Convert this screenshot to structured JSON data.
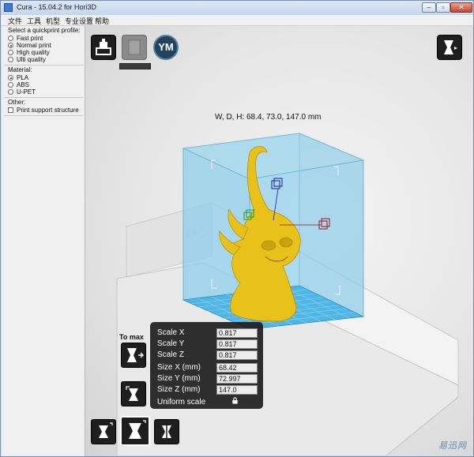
{
  "window": {
    "title": "Cura - 15.04.2 for Hori3D"
  },
  "menu": [
    {
      "label": "文件"
    },
    {
      "label": "工具"
    },
    {
      "label": "机型"
    },
    {
      "label": "专业设置"
    },
    {
      "label": "帮助"
    }
  ],
  "sidebar": {
    "quickprint_label": "Select a quickprint profile:",
    "profiles": [
      {
        "label": "Fast print",
        "selected": false
      },
      {
        "label": "Normal print",
        "selected": true
      },
      {
        "label": "High quality",
        "selected": false
      },
      {
        "label": "Ulti quality",
        "selected": false
      }
    ],
    "material_label": "Material:",
    "materials": [
      {
        "label": "PLA",
        "selected": true
      },
      {
        "label": "ABS",
        "selected": false
      },
      {
        "label": "U-PET",
        "selected": false
      }
    ],
    "other_label": "Other:",
    "support": {
      "label": "Print support structure",
      "checked": false
    }
  },
  "toolbar": {
    "ym_label": "YM"
  },
  "viewport": {
    "dimensions_text": "W, D, H: 68.4, 73.0, 147.0 mm"
  },
  "scale_panel": {
    "rows": [
      {
        "label": "Scale X",
        "value": "0.817"
      },
      {
        "label": "Scale Y",
        "value": "0.817"
      },
      {
        "label": "Scale Z",
        "value": "0.817"
      },
      {
        "label": "Size X (mm)",
        "value": "68.42"
      },
      {
        "label": "Size Y (mm)",
        "value": "72.997"
      },
      {
        "label": "Size Z (mm)",
        "value": "147.0"
      }
    ],
    "uniform_label": "Uniform scale"
  },
  "tools": {
    "to_max_label": "To max"
  },
  "watermark": "易迅网",
  "colors": {
    "model": "#e8c21b",
    "volume": "#8fcfe9",
    "bed_grid": "#38a8e0",
    "panel": "#191919"
  }
}
